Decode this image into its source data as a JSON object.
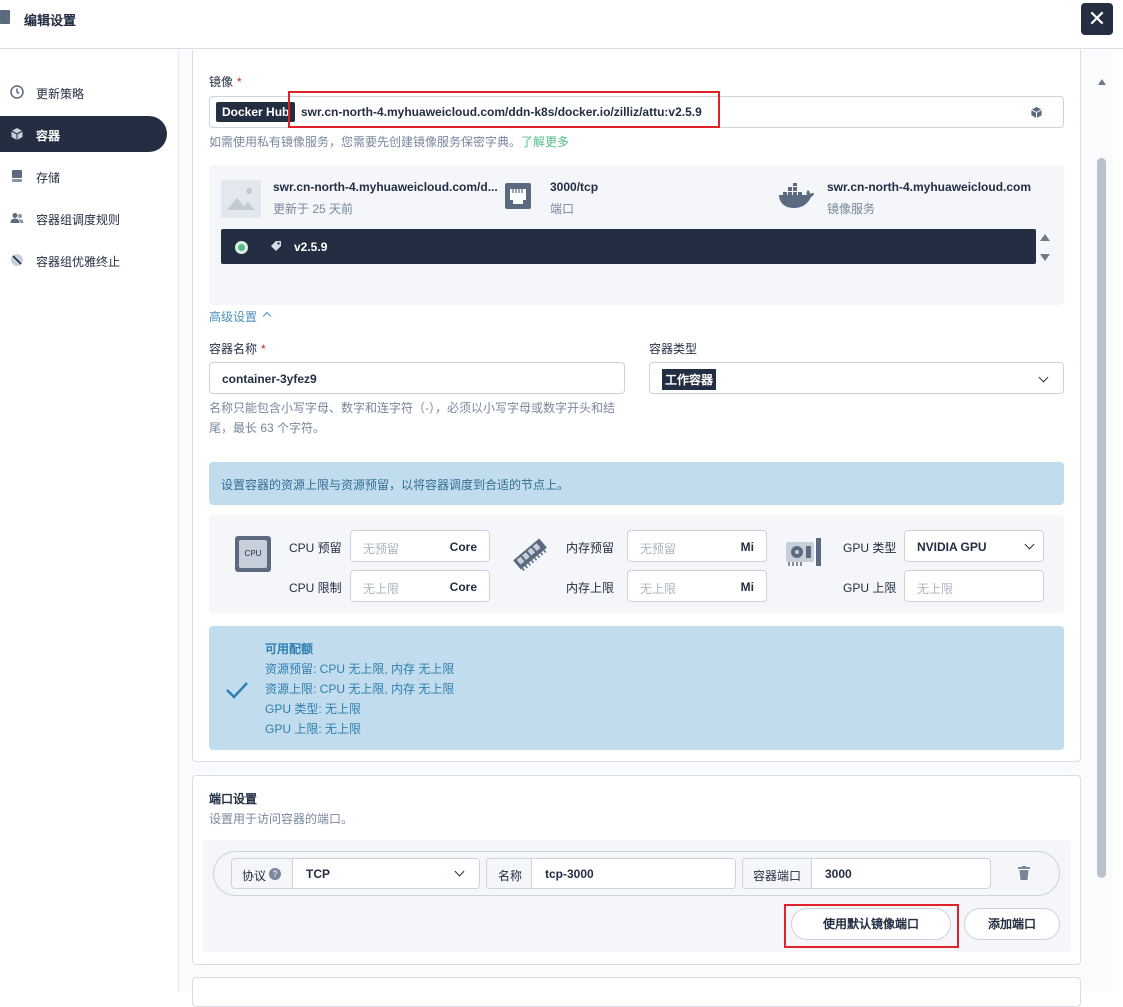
{
  "header": {
    "title": "编辑设置",
    "close_symbol": "✕"
  },
  "sidebar": {
    "items": [
      {
        "label": "更新策略",
        "icon": "clock-icon"
      },
      {
        "label": "容器",
        "icon": "container-icon"
      },
      {
        "label": "存储",
        "icon": "storage-icon"
      },
      {
        "label": "容器组调度规则",
        "icon": "users-icon"
      },
      {
        "label": "容器组优雅终止",
        "icon": "slash-icon"
      }
    ]
  },
  "image": {
    "label": "镜像",
    "required": "*",
    "registry_badge": "Docker Hub",
    "value": "swr.cn-north-4.myhuaweicloud.com/ddn-k8s/docker.io/zilliz/attu:v2.5.9",
    "hint_prefix": "如需使用私有镜像服务，您需要先创建镜像服务保密字典。",
    "hint_link": "了解更多",
    "info": {
      "name": "swr.cn-north-4.myhuaweicloud.com/d...",
      "updated": "更新于 25 天前",
      "port": "3000/tcp",
      "port_label": "端口",
      "registry": "swr.cn-north-4.myhuaweicloud.com",
      "registry_label": "镜像服务"
    },
    "tag": "v2.5.9"
  },
  "advanced": {
    "toggle_label": "高级设置",
    "container_name_label": "容器名称",
    "container_name_value": "container-3yfez9",
    "container_name_hint_1": "名称只能包含小写字母、数字和连字符（-），必须以小写字母或数字开头和结",
    "container_name_hint_2": "尾，最长 63 个字符。",
    "container_type_label": "容器类型",
    "container_type_value": "工作容器"
  },
  "resources": {
    "banner": "设置容器的资源上限与资源预留，以将容器调度到合适的节点上。",
    "cpu_reserve_label": "CPU 预留",
    "cpu_reserve_placeholder": "无预留",
    "cpu_limit_label": "CPU 限制",
    "cpu_limit_placeholder": "无上限",
    "cpu_unit": "Core",
    "cpu_chip_text": "CPU",
    "mem_reserve_label": "内存预留",
    "mem_reserve_placeholder": "无预留",
    "mem_limit_label": "内存上限",
    "mem_limit_placeholder": "无上限",
    "mem_unit": "Mi",
    "gpu_type_label": "GPU 类型",
    "gpu_type_value": "NVIDIA GPU",
    "gpu_limit_label": "GPU 上限",
    "gpu_limit_placeholder": "无上限"
  },
  "quota": {
    "title": "可用配额",
    "line1": "资源预留:  CPU 无上限, 内存 无上限",
    "line2": "资源上限:  CPU 无上限, 内存 无上限",
    "line3": "GPU 类型:  无上限",
    "line4": "GPU 上限:  无上限"
  },
  "ports": {
    "title": "端口设置",
    "subtitle": "设置用于访问容器的端口。",
    "protocol_label": "协议",
    "protocol_help": "?",
    "protocol_value": "TCP",
    "name_label": "名称",
    "name_value": "tcp-3000",
    "container_port_label": "容器端口",
    "container_port_value": "3000",
    "use_default_button": "使用默认镜像端口",
    "add_port_button": "添加端口"
  },
  "colors": {
    "accent": "#242e42",
    "link": "#55bc8a",
    "banner_bg": "#c1dcec",
    "highlight": "#e0202b"
  }
}
